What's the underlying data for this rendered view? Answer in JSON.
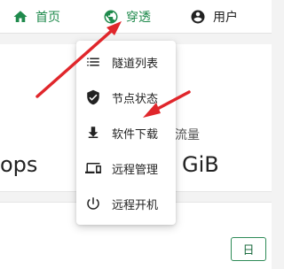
{
  "nav": {
    "home_label": "首页",
    "tunnel_label": "穿透",
    "user_label": "用户"
  },
  "menu": {
    "items": [
      {
        "label": "隧道列表",
        "icon": "list-icon"
      },
      {
        "label": "节点状态",
        "icon": "shield-check-icon"
      },
      {
        "label": "软件下载",
        "icon": "download-icon"
      },
      {
        "label": "远程管理",
        "icon": "devices-icon"
      },
      {
        "label": "远程开机",
        "icon": "power-icon"
      }
    ]
  },
  "background": {
    "stat_label_fragment": "流量",
    "stat_value_left_fragment": "ops",
    "stat_value_right_fragment": "GiB",
    "day_button_label": "日"
  },
  "colors": {
    "accent": "#1f8a4c",
    "annotation": "#e0262b"
  }
}
